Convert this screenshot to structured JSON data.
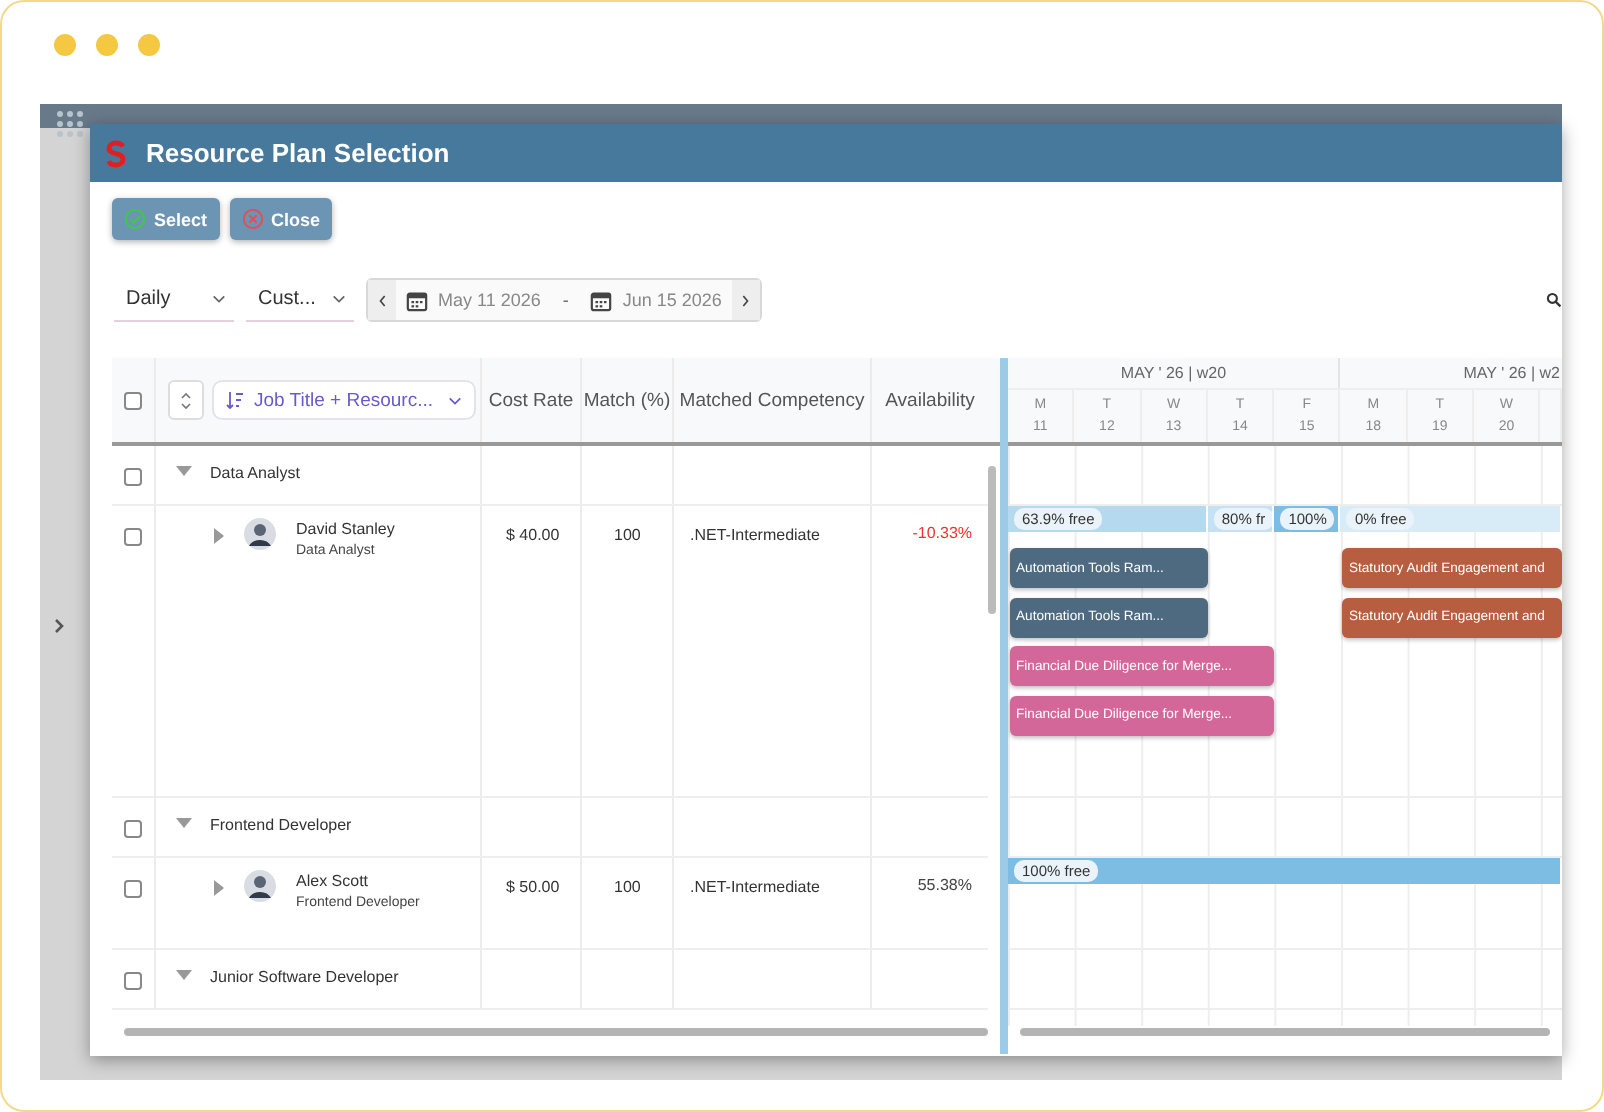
{
  "window": {
    "title": "Resource Plan Selection"
  },
  "toolbar": {
    "buttons": [
      {
        "label": "Select",
        "kind": "select"
      },
      {
        "label": "Close",
        "kind": "close"
      }
    ]
  },
  "filters": {
    "view": "Daily",
    "range_mode": "Cust...",
    "date_from": "May 11 2026",
    "separator": "-",
    "date_to": "Jun 15 2026"
  },
  "grid": {
    "select_all": {
      "checked": false
    },
    "grouping": "Job Title + Resourc...",
    "columns": [
      "Cost Rate",
      "Match (%)",
      "Matched Competency",
      "Availability"
    ],
    "groups": [
      {
        "title": "Data Analyst",
        "checked": false,
        "expanded": true,
        "resources": [
          {
            "name": "David Stanley",
            "role": "Data Analyst",
            "cost_rate": "$ 40.00",
            "match": "100",
            "competency": ".NET-Intermediate",
            "availability": "-10.33%",
            "overbooked": true,
            "checked": false,
            "expanded": false,
            "availability_segments": [
              {
                "label": "63.9% free",
                "color": "#b5daf0"
              },
              {
                "label": "80% fr",
                "color": "#c4e2f3"
              },
              {
                "label": "100%",
                "color": "#7dbde3"
              },
              {
                "label": "0% free",
                "color": "#d8ecf7"
              }
            ],
            "tasks": [
              {
                "title": "Automation Tools Ram...",
                "color": "#4e6a80"
              },
              {
                "title": "Statutory Audit Engagement and",
                "color": "#b85e40"
              },
              {
                "title": "Automation Tools Ram...",
                "color": "#4e6a80"
              },
              {
                "title": "Statutory Audit Engagement and",
                "color": "#b85e40"
              },
              {
                "title": "Financial Due Diligence for Merge...",
                "color": "#d4679a"
              },
              {
                "title": "Financial Due Diligence for Merge...",
                "color": "#d4679a"
              }
            ]
          }
        ]
      },
      {
        "title": "Frontend Developer",
        "checked": false,
        "expanded": true,
        "resources": [
          {
            "name": "Alex Scott",
            "role": "Frontend Developer",
            "cost_rate": "$ 50.00",
            "match": "100",
            "competency": ".NET-Intermediate",
            "availability": "55.38%",
            "overbooked": false,
            "checked": false,
            "expanded": false,
            "availability_segments": [
              {
                "label": "100% free",
                "color": "#7dbde3"
              }
            ]
          }
        ]
      },
      {
        "title": "Junior Software Developer",
        "checked": false,
        "expanded": true
      }
    ]
  },
  "timeline": {
    "weeks": [
      {
        "label": "MAY ' 26 | w20"
      },
      {
        "label": "MAY ' 26 | w2"
      }
    ],
    "days": [
      {
        "weekday": "M",
        "date": "11"
      },
      {
        "weekday": "T",
        "date": "12"
      },
      {
        "weekday": "W",
        "date": "13"
      },
      {
        "weekday": "T",
        "date": "14"
      },
      {
        "weekday": "F",
        "date": "15"
      },
      {
        "weekday": "M",
        "date": "18"
      },
      {
        "weekday": "T",
        "date": "19"
      },
      {
        "weekday": "W",
        "date": "20"
      }
    ]
  }
}
